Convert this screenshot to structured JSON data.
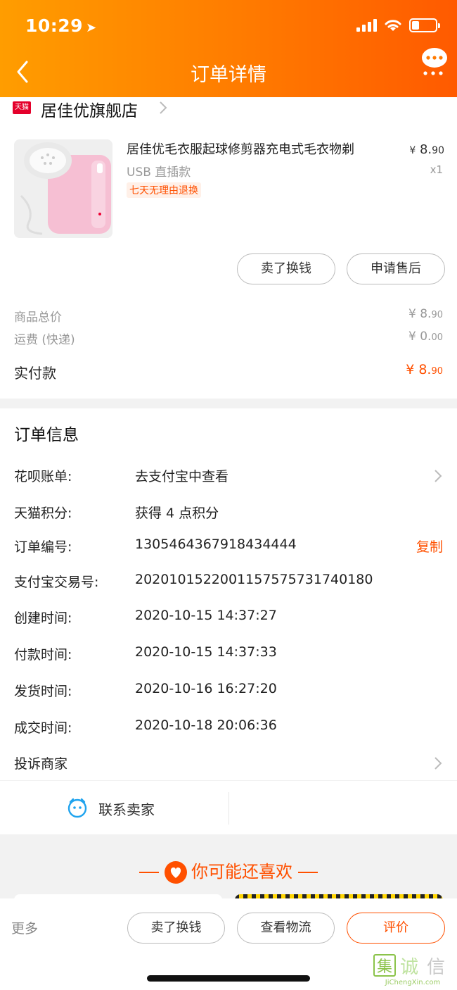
{
  "status_bar": {
    "time": "10:29"
  },
  "nav": {
    "title": "订单详情"
  },
  "shop": {
    "logo_text": "天猫",
    "name": "居佳优旗舰店"
  },
  "product": {
    "title": "居佳优毛衣服起球修剪器充电式毛衣物剃",
    "spec": "USB 直插款",
    "tag": "七天无理由退换",
    "price_symbol": "¥",
    "price_int": "8.",
    "price_dec": "90",
    "qty": "x1"
  },
  "actions": {
    "sell": "卖了换钱",
    "after_sale": "申请售后"
  },
  "summary": {
    "goods_label": "商品总价",
    "goods_int": "¥ 8.",
    "goods_dec": "90",
    "ship_label": "运费 (快递)",
    "ship_int": "¥ 0.",
    "ship_dec": "00",
    "paid_label": "实付款",
    "paid_int": "¥ 8.",
    "paid_dec": "90"
  },
  "order_info": {
    "title": "订单信息",
    "rows": [
      {
        "label": "花呗账单:",
        "value": "去支付宝中查看"
      },
      {
        "label": "天猫积分:",
        "value": "获得 4 点积分"
      },
      {
        "label": "订单编号:",
        "value": "1305464367918434444"
      },
      {
        "label": "支付宝交易号:",
        "value": "2020101522001157575731740180"
      },
      {
        "label": "创建时间:",
        "value": "2020-10-15 14:37:27"
      },
      {
        "label": "付款时间:",
        "value": "2020-10-15 14:37:33"
      },
      {
        "label": "发货时间:",
        "value": "2020-10-16 16:27:20"
      },
      {
        "label": "成交时间:",
        "value": "2020-10-18 20:06:36"
      },
      {
        "label": "投诉商家",
        "value": ""
      }
    ],
    "copy_label": "复制"
  },
  "contact": {
    "label": "联系卖家"
  },
  "recommend": {
    "title": "你可能还喜欢"
  },
  "bottom_bar": {
    "more": "更多",
    "sell": "卖了换钱",
    "logistics": "查看物流",
    "review": "评价"
  },
  "watermark": {
    "chars": "集诚信",
    "site": "JiChengXin.com"
  },
  "colors": {
    "accent": "#ff5000",
    "header_start": "#ff9d00",
    "header_end": "#ff5a00"
  }
}
